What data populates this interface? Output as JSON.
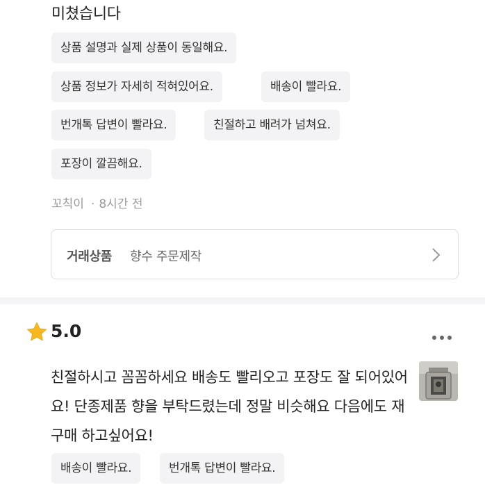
{
  "review1": {
    "text_tail": "미쳤습니다",
    "tags": [
      "상품 설명과 실제 상품이 동일해요.",
      "상품 정보가 자세히 적혀있어요.",
      "배송이 빨라요.",
      "번개톡 답변이 빨라요.",
      "친절하고 배려가 넘쳐요.",
      "포장이 깔끔해요."
    ],
    "author": "꼬칙이",
    "time": "8시간 전",
    "product_label": "거래상품",
    "product_name": "향수 주문제작"
  },
  "review2": {
    "rating": "5.0",
    "text": "친절하시고 꼼꼼하세요 배송도 빨리오고 포장도 잘 되어있어요! 단종제품 향을 부탁드렸는데 정말 비슷해요 다음에도 재구매 하고싶어요!",
    "tags": [
      "배송이 빨라요.",
      "번개톡 답변이 빨라요."
    ]
  },
  "colors": {
    "tag_bg": "#f3f3f5",
    "star": "#f6b71f",
    "meta": "#999999"
  },
  "icons": {
    "rating": "star-icon",
    "menu": "more-options-icon",
    "product": "chevron-right-icon"
  }
}
